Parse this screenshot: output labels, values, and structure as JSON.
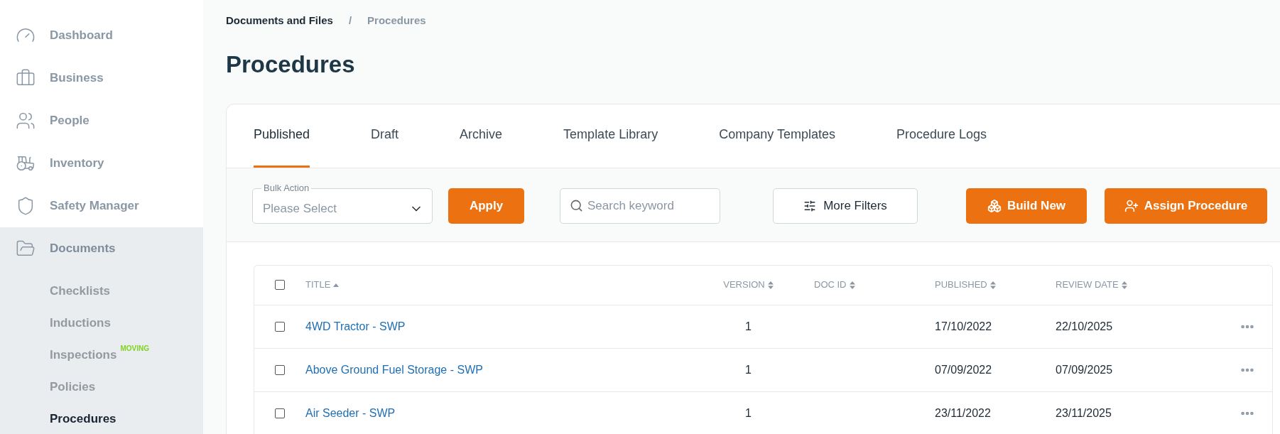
{
  "sidebar": {
    "items": [
      {
        "label": "Dashboard",
        "selected": false
      },
      {
        "label": "Business",
        "selected": false
      },
      {
        "label": "People",
        "selected": false
      },
      {
        "label": "Inventory",
        "selected": false
      },
      {
        "label": "Safety Manager",
        "selected": false
      },
      {
        "label": "Documents",
        "selected": true,
        "expanded": true,
        "children": [
          {
            "label": "Checklists",
            "selected": false
          },
          {
            "label": "Inductions",
            "selected": false
          },
          {
            "label": "Inspections",
            "badge": "MOVING",
            "selected": false
          },
          {
            "label": "Policies",
            "selected": false
          },
          {
            "label": "Procedures",
            "selected": true
          }
        ]
      }
    ]
  },
  "breadcrumb": [
    "Documents and Files",
    "/",
    "Procedures"
  ],
  "page_title": "Procedures",
  "tabs": [
    {
      "label": "Published",
      "selected": true
    },
    {
      "label": "Draft",
      "selected": false
    },
    {
      "label": "Archive",
      "selected": false
    },
    {
      "label": "Template Library",
      "selected": false
    },
    {
      "label": "Company Templates",
      "selected": false
    },
    {
      "label": "Procedure Logs",
      "selected": false
    }
  ],
  "toolbar": {
    "bulk_action": {
      "label": "Bulk Action",
      "placeholder": "Please Select"
    },
    "apply": "Apply",
    "search": {
      "placeholder": "Search keyword"
    },
    "more_filters": "More Filters",
    "build_new": "Build New",
    "assign": "Assign Procedure"
  },
  "table": {
    "select_all": {
      "checked": false
    },
    "columns": [
      {
        "label": "TITLE",
        "sorted": true
      },
      {
        "label": "VERSION",
        "sorted": false
      },
      {
        "label": "DOC ID",
        "sorted": false
      },
      {
        "label": "PUBLISHED",
        "sorted": false
      },
      {
        "label": "REVIEW DATE",
        "sorted": false
      }
    ],
    "rows": [
      {
        "checked": false,
        "title": "4WD Tractor - SWP",
        "version": "1",
        "published": "17/10/2022",
        "review_date": "22/10/2025"
      },
      {
        "checked": false,
        "title": "Above Ground Fuel Storage - SWP",
        "version": "1",
        "published": "07/09/2022",
        "review_date": "07/09/2025"
      },
      {
        "checked": false,
        "title": "Air Seeder - SWP",
        "version": "1",
        "published": "23/11/2022",
        "review_date": "23/11/2025"
      }
    ]
  }
}
